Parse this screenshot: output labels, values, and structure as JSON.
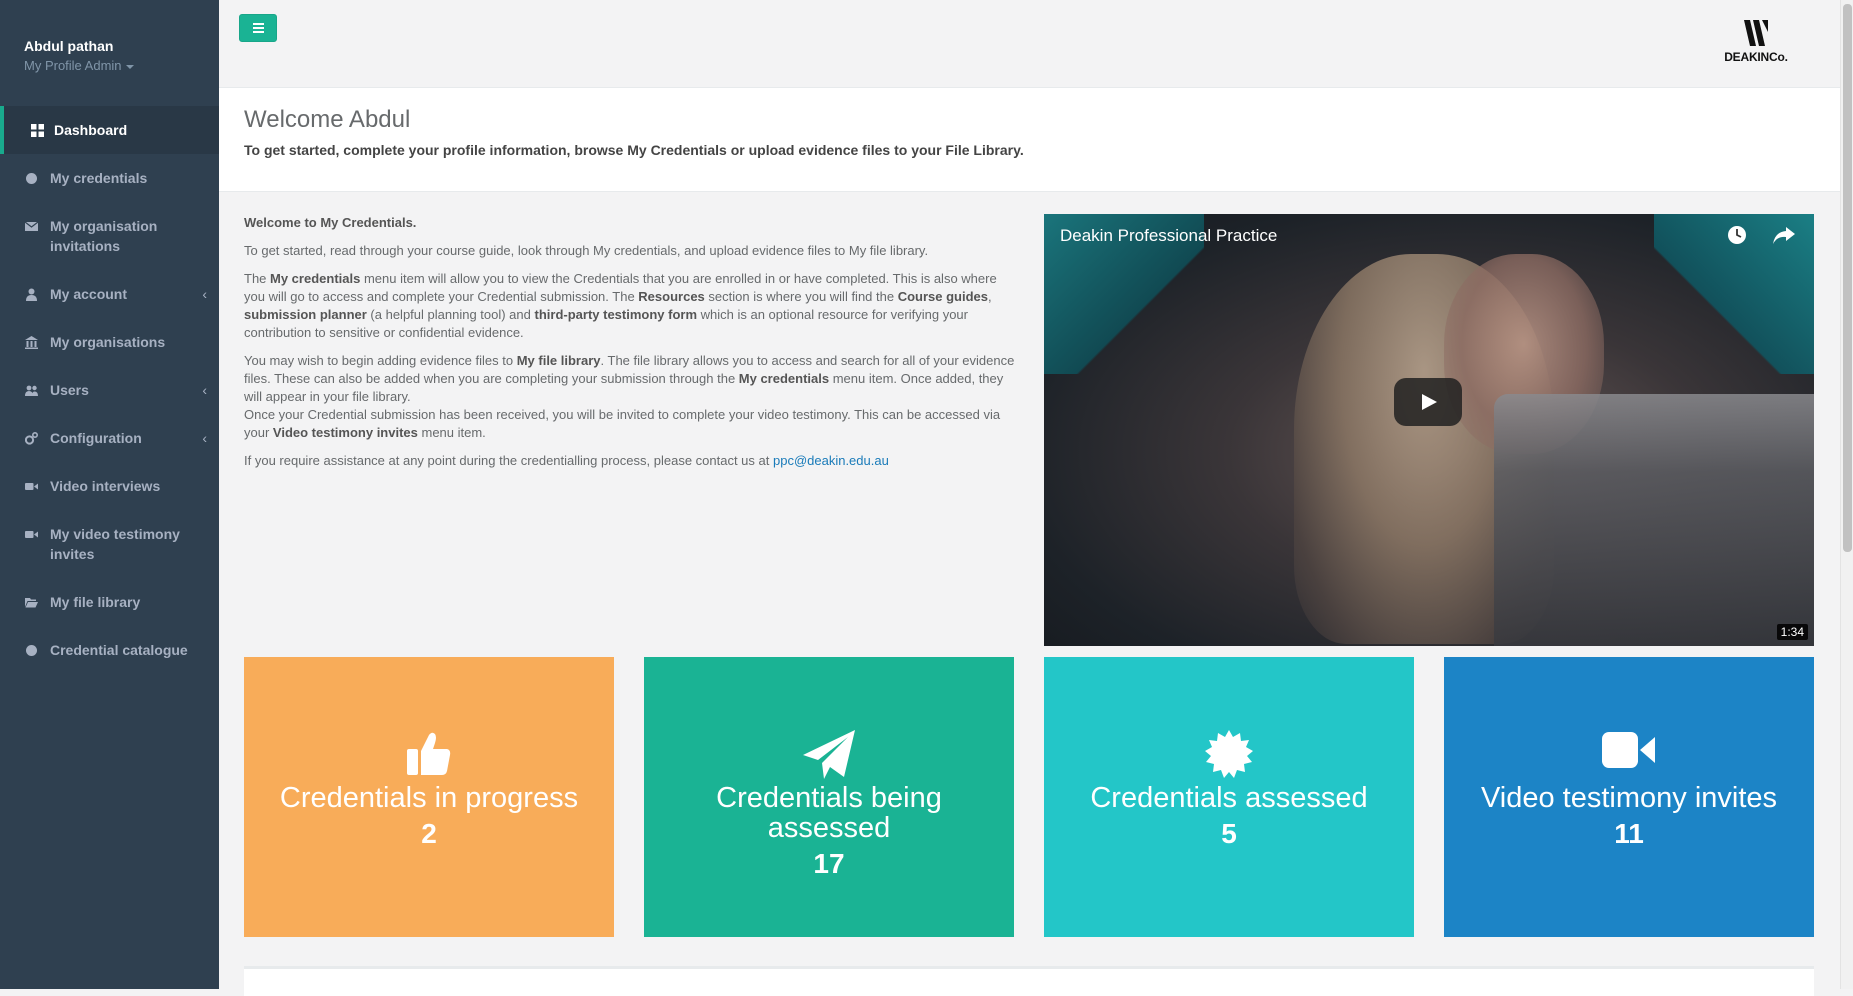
{
  "profile": {
    "name": "Abdul pathan",
    "role": "My Profile Admin"
  },
  "nav": [
    {
      "label": "Dashboard",
      "icon": "dashboard-icon",
      "active": true
    },
    {
      "label": "My credentials",
      "icon": "certificate-icon"
    },
    {
      "label": "My organisation invitations",
      "icon": "envelope-icon"
    },
    {
      "label": "My account",
      "icon": "user-icon",
      "arrow": "‹"
    },
    {
      "label": "My organisations",
      "icon": "bank-icon"
    },
    {
      "label": "Users",
      "icon": "users-icon",
      "arrow": "‹"
    },
    {
      "label": "Configuration",
      "icon": "cogs-icon",
      "arrow": "‹"
    },
    {
      "label": "Video interviews",
      "icon": "video-camera-icon"
    },
    {
      "label": "My video testimony invites",
      "icon": "video-camera-icon"
    },
    {
      "label": "My file library",
      "icon": "folder-open-icon"
    },
    {
      "label": "Credential catalogue",
      "icon": "certificate-icon"
    }
  ],
  "logo": {
    "text": "DEAKINCo."
  },
  "welcome": {
    "title": "Welcome Abdul",
    "subtitle": "To get started, complete your profile information, browse My Credentials or upload evidence files to your File Library."
  },
  "intro": {
    "heading": "Welcome to My Credentials.",
    "p1": "To get started, read through your course guide, look through My credentials, and upload evidence files to My file library.",
    "p2": {
      "t1": "The ",
      "b1": "My credentials",
      "t2": " menu item will allow you to view the Credentials that you are enrolled in or have completed. This is also where you will go to access and complete your Credential submission. The ",
      "b2": "Resources",
      "t3": " section is where you will find the ",
      "b3": "Course guides",
      "t4": ", ",
      "b4": "submission planner",
      "t5": " (a helpful planning tool) and ",
      "b5": "third-party testimony form",
      "t6": " which is an optional resource for verifying your contribution to sensitive or confidential evidence."
    },
    "p3": {
      "t1": "You may wish to begin adding evidence files to ",
      "b1": "My file library",
      "t2": ". The file library allows you to access and search for all of your evidence files.  These can also be added when you are completing your submission through the ",
      "b2": "My credentials",
      "t3": " menu item. Once added, they will appear in your file library.",
      "t4": "Once your Credential submission has been received, you will be invited to complete your video testimony. This can be accessed via your ",
      "b3": "Video testimony invites",
      "t5": " menu item."
    },
    "p4": {
      "text": "If you require assistance at any point during the credentialling process, please contact us at ",
      "email": "ppc@deakin.edu.au"
    }
  },
  "video": {
    "title": "Deakin Professional Practice",
    "duration": "1:34"
  },
  "tiles": [
    {
      "label": "Credentials in progress",
      "value": "2",
      "icon": "thumbs-up-icon",
      "color": "#f8ac59"
    },
    {
      "label": "Credentials being assessed",
      "value": "17",
      "icon": "paper-plane-icon",
      "color": "#1ab394"
    },
    {
      "label": "Credentials assessed",
      "value": "5",
      "icon": "certificate-icon",
      "color": "#23c6c8"
    },
    {
      "label": "Video testimony invites",
      "value": "11",
      "icon": "video-camera-icon",
      "color": "#1c84c6"
    }
  ],
  "colors": {
    "sidebar": "#2f4050",
    "accent": "#1ab394"
  }
}
